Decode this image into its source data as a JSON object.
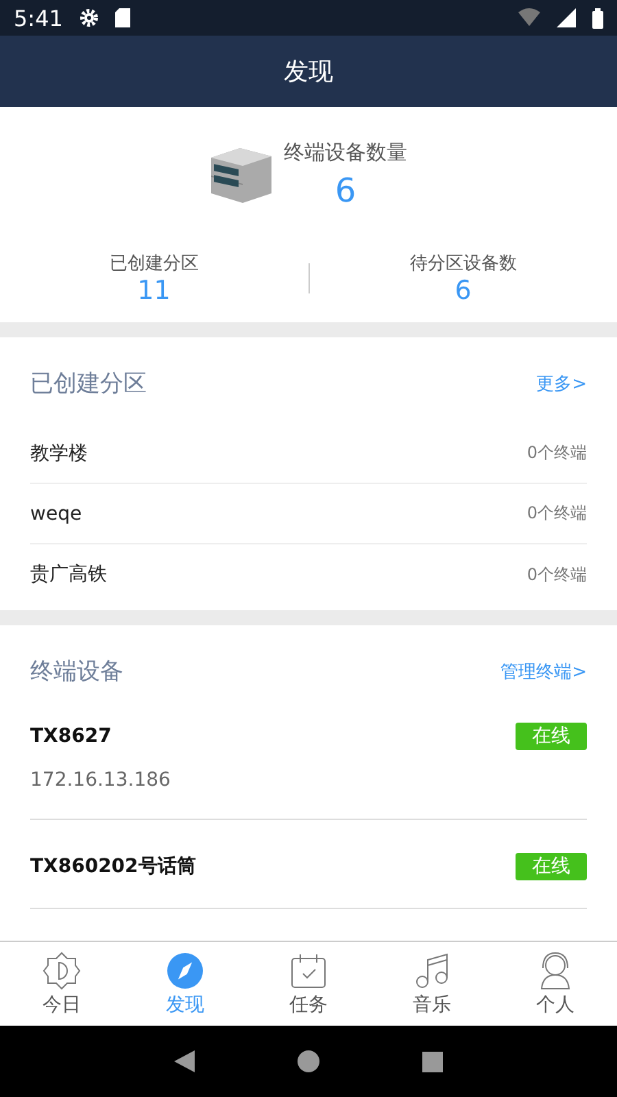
{
  "status_bar": {
    "time": "5:41"
  },
  "header": {
    "title": "发现"
  },
  "summary": {
    "label": "终端设备数量",
    "value": "6",
    "stats": [
      {
        "label": "已创建分区",
        "value": "11"
      },
      {
        "label": "待分区设备数",
        "value": "6"
      }
    ]
  },
  "partitions": {
    "title": "已创建分区",
    "link": "更多>",
    "items": [
      {
        "name": "教学楼",
        "count": "0个终端"
      },
      {
        "name": "weqe",
        "count": "0个终端"
      },
      {
        "name": "贵广高铁",
        "count": "0个终端"
      }
    ]
  },
  "terminals": {
    "title": "终端设备",
    "link": "管理终端>",
    "items": [
      {
        "name": "TX8627",
        "status": "在线",
        "ip": "172.16.13.186"
      },
      {
        "name": "TX860202号话筒",
        "status": "在线"
      }
    ]
  },
  "tabs": [
    {
      "label": "今日",
      "kind": "today",
      "selected": false
    },
    {
      "label": "发现",
      "kind": "discover",
      "selected": true
    },
    {
      "label": "任务",
      "kind": "task",
      "selected": false
    },
    {
      "label": "音乐",
      "kind": "music",
      "selected": false
    },
    {
      "label": "个人",
      "kind": "profile",
      "selected": false
    }
  ]
}
